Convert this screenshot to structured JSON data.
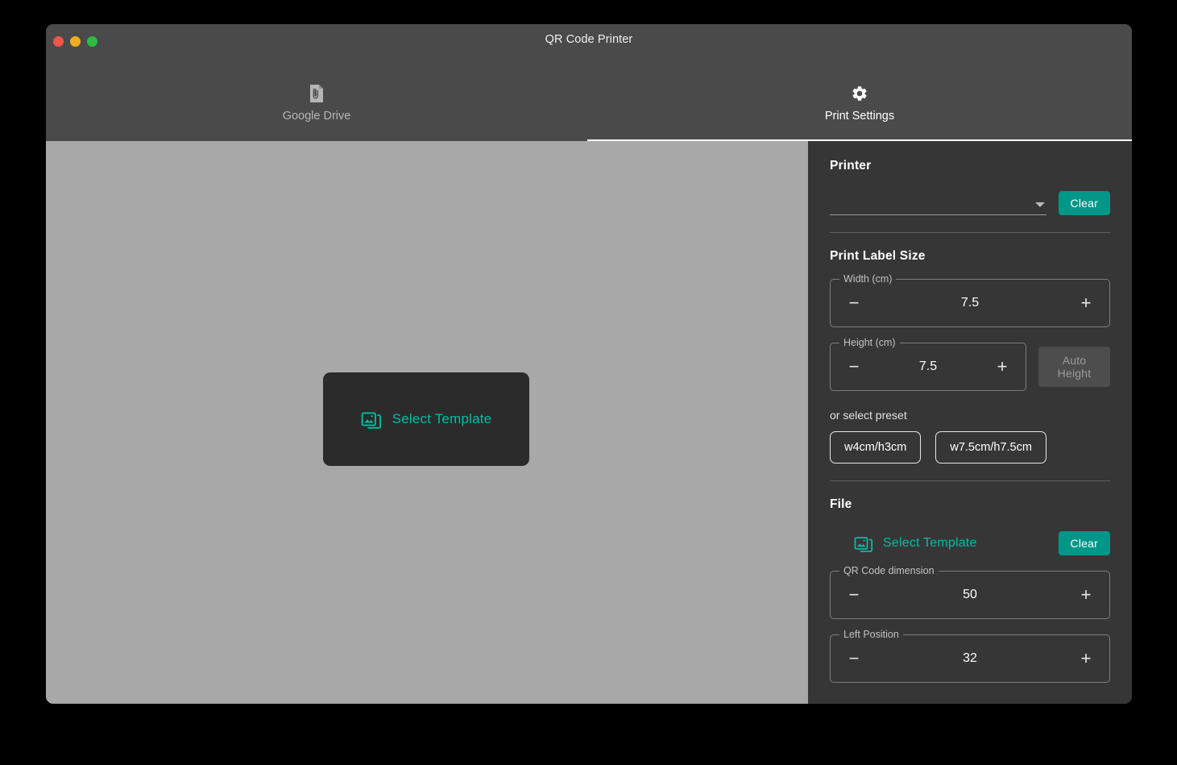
{
  "window": {
    "title": "QR Code Printer",
    "traffic_lights": [
      "close-button",
      "minimize-button",
      "zoom-button"
    ]
  },
  "tabs": [
    {
      "id": "google-drive",
      "label": "Google Drive",
      "icon": "attach-file-icon",
      "active": false
    },
    {
      "id": "print-settings",
      "label": "Print Settings",
      "icon": "gear-icon",
      "active": true
    }
  ],
  "preview": {
    "select_template_label": "Select Template",
    "select_template_icon": "photo-library-icon"
  },
  "settings": {
    "printer": {
      "title": "Printer",
      "selected_value": "",
      "placeholder": "",
      "caret_icon": "chevron-down-icon",
      "clear_label": "Clear"
    },
    "print_label_size": {
      "title": "Print Label Size",
      "width": {
        "legend": "Width (cm)",
        "value": "7.5",
        "minus": "−",
        "plus": "+"
      },
      "height": {
        "legend": "Height (cm)",
        "value": "7.5",
        "minus": "−",
        "plus": "+"
      },
      "auto_height_label": "Auto Height",
      "preset_label": "or select preset",
      "presets": [
        "w4cm/h3cm",
        "w7.5cm/h7.5cm"
      ]
    },
    "file": {
      "title": "File",
      "select_template_label": "Select Template",
      "select_template_icon": "photo-library-icon",
      "clear_label": "Clear",
      "qr_dimension": {
        "legend": "QR Code dimension",
        "value": "50",
        "minus": "−",
        "plus": "+"
      },
      "left_position": {
        "legend": "Left Position",
        "value": "32",
        "minus": "−",
        "plus": "+"
      }
    }
  },
  "colors": {
    "accent_teal": "#009688",
    "accent_teal_text": "#00bfa5",
    "panel_bg": "#363636",
    "chrome_bg": "#4a4a4a",
    "preview_bg": "#a8a8a8"
  }
}
